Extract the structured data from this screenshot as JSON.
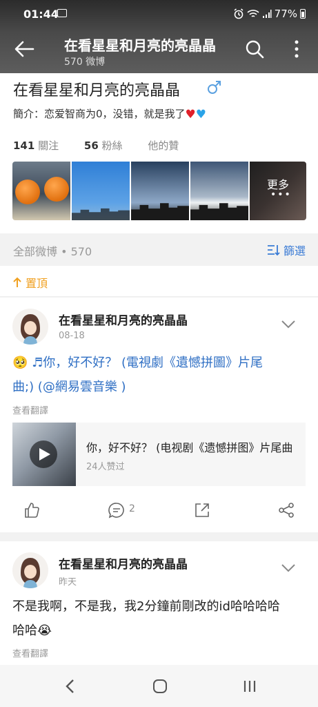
{
  "status": {
    "time": "01:44",
    "battery": "77%"
  },
  "nav": {
    "title": "在看星星和月亮的亮晶晶",
    "subtitle": "570 微博"
  },
  "profile": {
    "name": "在看星星和月亮的亮晶晶",
    "bio": "簡介：恋爱智商为0，没错，就是我了",
    "stats": [
      {
        "num": "141",
        "label": "關注"
      },
      {
        "num": "56",
        "label": "粉絲"
      },
      {
        "num": "",
        "label": "他的贊"
      }
    ],
    "more_label": "更多"
  },
  "filter": {
    "all_posts": "全部微博 • 570",
    "filter_label": "篩選"
  },
  "pin": {
    "label": "置頂"
  },
  "posts": [
    {
      "user": "在看星星和月亮的亮晶晶",
      "time": "08-18",
      "text_line1": "♬你，好不好？ (電視劇《遺憾拼圖》片尾",
      "text_line2": "曲;) (@網易雲音樂 )",
      "translate": "查看翻譯",
      "media_title": "你，好不好？ (电视剧《遗憾拼图》片尾曲",
      "media_sub": "24人赞过",
      "comment_count": "2"
    },
    {
      "user": "在看星星和月亮的亮晶晶",
      "time": "昨天",
      "text_line1": "不是我啊，不是我，我2分鐘前剛改的id哈哈哈哈",
      "text_line2": "哈哈",
      "translate": "查看翻譯"
    }
  ],
  "colors": {
    "accent_blue": "#2f6fc4",
    "pin_orange": "#f0a020"
  }
}
